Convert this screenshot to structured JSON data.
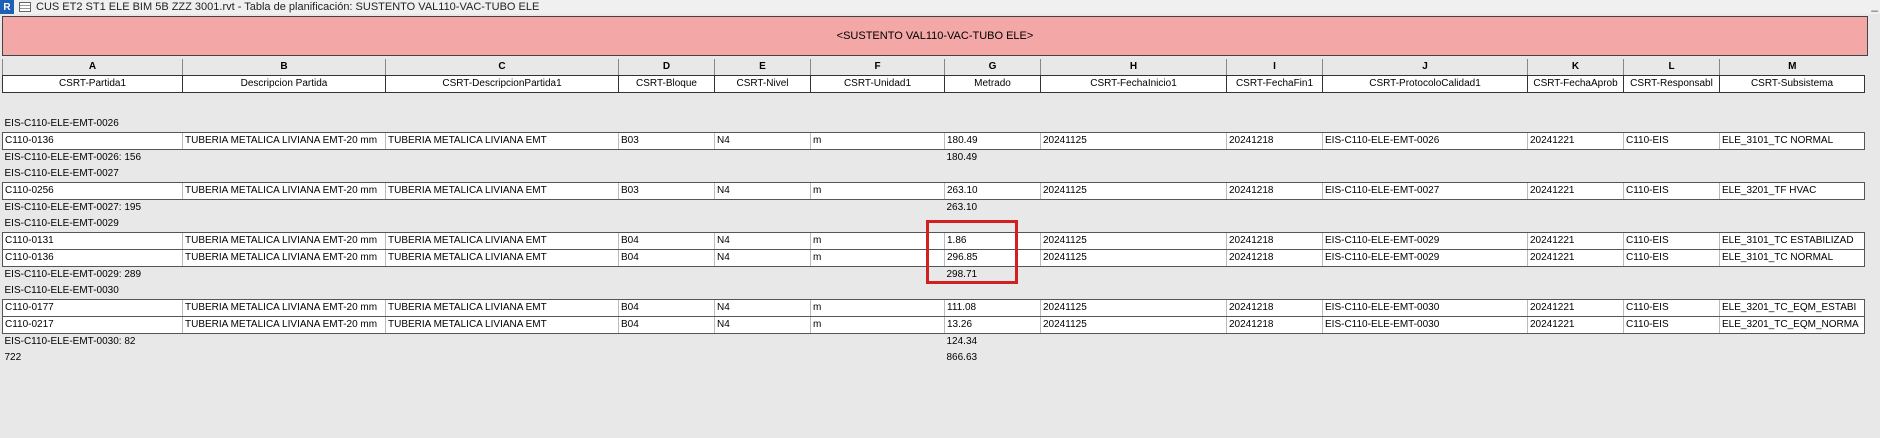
{
  "window": {
    "app_icon": "R",
    "title": "CUS ET2 ST1 ELE BIM 5B ZZZ 3001.rvt - Tabla de planificación: SUSTENTO VAL110-VAC-TUBO ELE",
    "close_glyph": "_"
  },
  "schedule": {
    "title": "<SUSTENTO VAL110-VAC-TUBO ELE>",
    "column_letters": [
      "A",
      "B",
      "C",
      "D",
      "E",
      "F",
      "G",
      "H",
      "I",
      "J",
      "K",
      "L",
      "M"
    ],
    "column_headers": [
      "CSRT-Partida1",
      "Descripcion Partida",
      "CSRT-DescripcionPartida1",
      "CSRT-Bloque",
      "CSRT-Nivel",
      "CSRT-Unidad1",
      "Metrado",
      "CSRT-FechaInicio1",
      "CSRT-FechaFin1",
      "CSRT-ProtocoloCalidad1",
      "CSRT-FechaAprob",
      "CSRT-Responsabl",
      "CSRT-Subsistema"
    ],
    "groups": [
      {
        "label": "EIS-C110-ELE-EMT-0026",
        "rows": [
          [
            "C110-0136",
            "TUBERIA METALICA LIVIANA EMT-20 mm",
            "TUBERIA METALICA LIVIANA EMT",
            "B03",
            "N4",
            "m",
            "180.49",
            "20241125",
            "20241218",
            "EIS-C110-ELE-EMT-0026",
            "20241221",
            "C110-EIS",
            "ELE_3101_TC NORMAL"
          ]
        ],
        "subtotal_label": "EIS-C110-ELE-EMT-0026: 156",
        "subtotal_value": "180.49"
      },
      {
        "label": "EIS-C110-ELE-EMT-0027",
        "rows": [
          [
            "C110-0256",
            "TUBERIA METALICA LIVIANA EMT-20 mm",
            "TUBERIA METALICA LIVIANA EMT",
            "B03",
            "N4",
            "m",
            "263.10",
            "20241125",
            "20241218",
            "EIS-C110-ELE-EMT-0027",
            "20241221",
            "C110-EIS",
            "ELE_3201_TF HVAC"
          ]
        ],
        "subtotal_label": "EIS-C110-ELE-EMT-0027: 195",
        "subtotal_value": "263.10"
      },
      {
        "label": "EIS-C110-ELE-EMT-0029",
        "rows": [
          [
            "C110-0131",
            "TUBERIA METALICA LIVIANA EMT-20 mm",
            "TUBERIA METALICA LIVIANA EMT",
            "B04",
            "N4",
            "m",
            "1.86",
            "20241125",
            "20241218",
            "EIS-C110-ELE-EMT-0029",
            "20241221",
            "C110-EIS",
            "ELE_3101_TC ESTABILIZAD"
          ],
          [
            "C110-0136",
            "TUBERIA METALICA LIVIANA EMT-20 mm",
            "TUBERIA METALICA LIVIANA EMT",
            "B04",
            "N4",
            "m",
            "296.85",
            "20241125",
            "20241218",
            "EIS-C110-ELE-EMT-0029",
            "20241221",
            "C110-EIS",
            "ELE_3101_TC NORMAL"
          ]
        ],
        "subtotal_label": "EIS-C110-ELE-EMT-0029: 289",
        "subtotal_value": "298.71"
      },
      {
        "label": "EIS-C110-ELE-EMT-0030",
        "rows": [
          [
            "C110-0177",
            "TUBERIA METALICA LIVIANA EMT-20 mm",
            "TUBERIA METALICA LIVIANA EMT",
            "B04",
            "N4",
            "m",
            "111.08",
            "20241125",
            "20241218",
            "EIS-C110-ELE-EMT-0030",
            "20241221",
            "C110-EIS",
            "ELE_3201_TC_EQM_ESTABI"
          ],
          [
            "C110-0217",
            "TUBERIA METALICA LIVIANA EMT-20 mm",
            "TUBERIA METALICA LIVIANA EMT",
            "B04",
            "N4",
            "m",
            "13.26",
            "20241125",
            "20241218",
            "EIS-C110-ELE-EMT-0030",
            "20241221",
            "C110-EIS",
            "ELE_3201_TC_EQM_NORMA"
          ]
        ],
        "subtotal_label": "EIS-C110-ELE-EMT-0030: 82",
        "subtotal_value": "124.34"
      }
    ],
    "grand_total_label": "722",
    "grand_total_value": "866.63"
  },
  "colors": {
    "header_band": "#f4a7a7",
    "highlight": "#d02020"
  }
}
